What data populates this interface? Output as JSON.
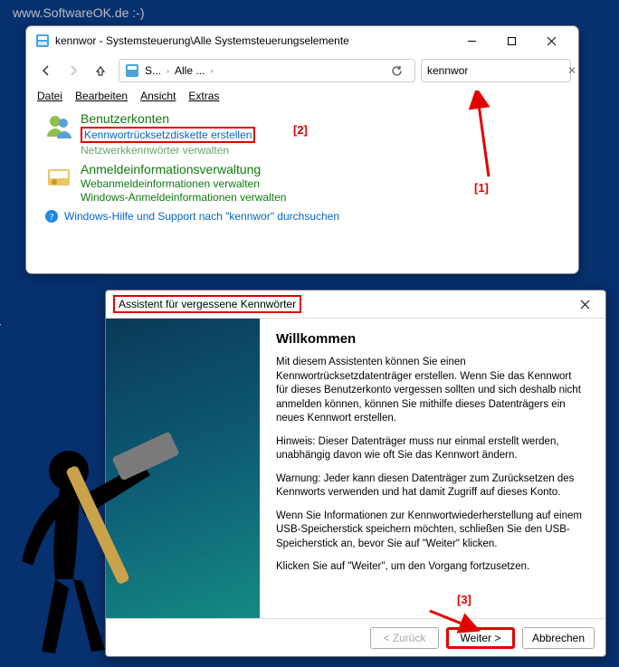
{
  "watermark": "www.SoftwareOK.de :-)",
  "cp": {
    "title": "kennwor - Systemsteuerung\\Alle Systemsteuerungselemente",
    "crumb1": "S...",
    "crumb2": "Alle ...",
    "search_value": "kennwor",
    "menu": {
      "file": "Datei",
      "edit": "Bearbeiten",
      "view": "Ansicht",
      "extras": "Extras"
    },
    "group1": {
      "head": "Benutzerkonten",
      "link1": "Kennwortrücksetzdiskette erstellen",
      "link2": "Netzwerkkennwörter verwalten"
    },
    "group2": {
      "head": "Anmeldeinformationsverwaltung",
      "link1": "Webanmeldeinformationen verwalten",
      "link2": "Windows-Anmeldeinformationen verwalten"
    },
    "help": "Windows-Hilfe und Support nach \"kennwor\" durchsuchen"
  },
  "anno": {
    "n1": "[1]",
    "n2": "[2]",
    "n3": "[3]"
  },
  "wizard": {
    "title": "Assistent für vergessene Kennwörter",
    "heading": "Willkommen",
    "p1": "Mit diesem Assistenten können Sie einen Kennwortrücksetzdatenträger erstellen. Wenn Sie das Kennwort für dieses Benutzerkonto vergessen sollten und sich deshalb nicht anmelden können, können Sie mithilfe dieses Datenträgers ein neues Kennwort erstellen.",
    "p2": "Hinweis: Dieser Datenträger muss nur einmal erstellt werden, unabhängig davon wie oft Sie das Kennwort ändern.",
    "p3": "Warnung: Jeder kann diesen Datenträger zum Zurücksetzen des Kennworts verwenden und hat damit Zugriff auf dieses Konto.",
    "p4": "Wenn Sie Informationen zur Kennwortwiederherstellung auf einem USB-Speicherstick speichern möchten, schließen Sie den USB-Speicherstick an, bevor Sie auf \"Weiter\" klicken.",
    "p5": "Klicken Sie auf \"Weiter\", um den Vorgang fortzusetzen.",
    "back": "< Zurück",
    "next": "Weiter >",
    "cancel": "Abbrechen"
  }
}
